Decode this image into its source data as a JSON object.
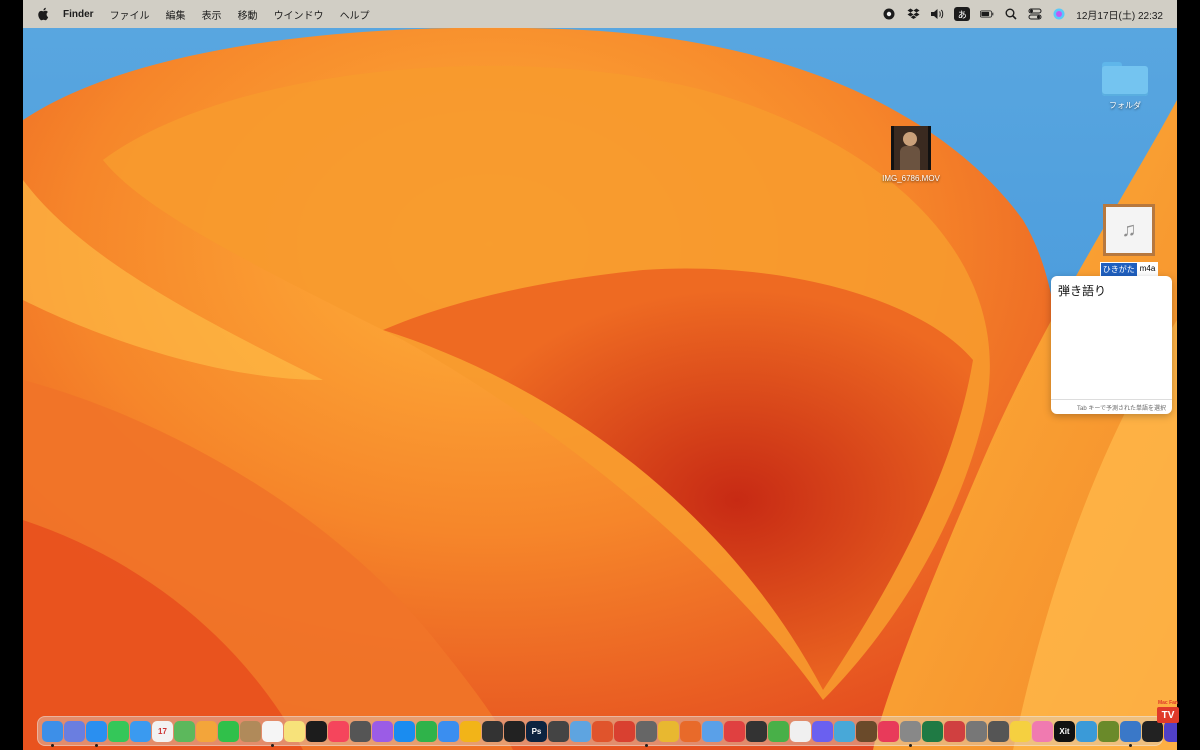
{
  "menubar": {
    "app_name": "Finder",
    "menus": [
      "ファイル",
      "編集",
      "表示",
      "移動",
      "ウインドウ",
      "ヘルプ"
    ],
    "input_source": "あ",
    "clock": "12月17日(土)  22:32"
  },
  "desktop": {
    "folder": {
      "label": "フォルダ"
    },
    "movie": {
      "label": "IMG_6786.MOV"
    },
    "audio": {
      "label_selected": "ひきがた",
      "label_rest": "m4a"
    }
  },
  "ime": {
    "candidate": "弾き語り",
    "hint": "Tab キーで予測された単語を選択"
  },
  "dock": {
    "apps": [
      {
        "icon": "finder-icon",
        "color": "#3d8fe8",
        "running": true
      },
      {
        "icon": "launchpad-icon",
        "color": "#6a7ee0",
        "running": false
      },
      {
        "icon": "safari-icon",
        "color": "#2a8ff0",
        "running": true
      },
      {
        "icon": "messages-icon",
        "color": "#34c759",
        "running": false
      },
      {
        "icon": "mail-icon",
        "color": "#3a9af0",
        "running": false
      },
      {
        "icon": "calendar-icon",
        "color": "#f2f2f2",
        "running": false,
        "text": "17"
      },
      {
        "icon": "maps-icon",
        "color": "#5cb85c",
        "running": false
      },
      {
        "icon": "photos-icon",
        "color": "#f3a53a",
        "running": false
      },
      {
        "icon": "facetime-icon",
        "color": "#30c04a",
        "running": false
      },
      {
        "icon": "contacts-icon",
        "color": "#b08a5a",
        "running": false
      },
      {
        "icon": "reminders-icon",
        "color": "#f5f5f5",
        "running": true
      },
      {
        "icon": "notes-icon",
        "color": "#f7e27a",
        "running": false
      },
      {
        "icon": "tv-icon",
        "color": "#1c1c1c",
        "running": false
      },
      {
        "icon": "music-icon",
        "color": "#f5455c",
        "running": false
      },
      {
        "icon": "podcasts-icon",
        "color": "#555",
        "running": false
      },
      {
        "icon": "podcasts-purple-icon",
        "color": "#9b5ce6",
        "running": false
      },
      {
        "icon": "appstore-icon",
        "color": "#1a8cf0",
        "running": false
      },
      {
        "icon": "numbers-icon",
        "color": "#2fb34a",
        "running": false
      },
      {
        "icon": "keynote-icon",
        "color": "#3a8ef0",
        "running": false
      },
      {
        "icon": "pencil-icon",
        "color": "#f2b418",
        "running": false
      },
      {
        "icon": "screenshot-icon",
        "color": "#333",
        "running": false
      },
      {
        "icon": "claquette-icon",
        "color": "#222",
        "running": false
      },
      {
        "icon": "photoshop-icon",
        "color": "#0d2440",
        "running": false,
        "text": "Ps"
      },
      {
        "icon": "finalcut-icon",
        "color": "#444",
        "running": false
      },
      {
        "icon": "preview-icon",
        "color": "#5ea4e0",
        "running": false
      },
      {
        "icon": "firefox-icon",
        "color": "#e0542c",
        "running": false
      },
      {
        "icon": "airplane-icon",
        "color": "#d94030",
        "running": false
      },
      {
        "icon": "microphone-icon",
        "color": "#666",
        "running": true
      },
      {
        "icon": "chrome-icon",
        "color": "#e8b830",
        "running": false
      },
      {
        "icon": "firefox-alt-icon",
        "color": "#e86a2a",
        "running": false
      },
      {
        "icon": "bird-icon",
        "color": "#5aa0e8",
        "running": false
      },
      {
        "icon": "target-icon",
        "color": "#e04040",
        "running": false
      },
      {
        "icon": "monitor-icon",
        "color": "#333",
        "running": false
      },
      {
        "icon": "checklist-icon",
        "color": "#48b048",
        "running": false
      },
      {
        "icon": "lasso-icon",
        "color": "#f0f0f0",
        "running": false
      },
      {
        "icon": "messenger-icon",
        "color": "#6a60f0",
        "running": false
      },
      {
        "icon": "finder-window-icon",
        "color": "#48a8d8",
        "running": false
      },
      {
        "icon": "game-icon",
        "color": "#6a4a2a",
        "running": false
      },
      {
        "icon": "play-icon",
        "color": "#e83a5a",
        "running": false
      },
      {
        "icon": "display-icon",
        "color": "#888",
        "running": true
      },
      {
        "icon": "excel-icon",
        "color": "#1f7a44",
        "running": false
      },
      {
        "icon": "shield-icon",
        "color": "#d04040",
        "running": false
      },
      {
        "icon": "mixer-icon",
        "color": "#777",
        "running": false
      },
      {
        "icon": "camera-icon",
        "color": "#555",
        "running": false
      },
      {
        "icon": "hand-icon",
        "color": "#f5d040",
        "running": false
      },
      {
        "icon": "grid-icon",
        "color": "#f07ab0",
        "running": false
      },
      {
        "icon": "xit-icon",
        "color": "#111",
        "running": false,
        "text": "Xit"
      },
      {
        "icon": "network-icon",
        "color": "#3a9ad8",
        "running": false
      },
      {
        "icon": "radar-icon",
        "color": "#6a8a2a",
        "running": false
      },
      {
        "icon": "person-icon",
        "color": "#3a78c8",
        "running": true
      },
      {
        "icon": "cube-icon",
        "color": "#222",
        "running": false
      },
      {
        "icon": "star-icon",
        "color": "#5040c8",
        "running": false
      }
    ],
    "trailing": [
      {
        "icon": "downloads-folder-icon",
        "color": "#5ab4e8"
      },
      {
        "icon": "trash-icon",
        "color": "#d8d8d8"
      }
    ]
  },
  "watermark": {
    "top": "Mac Fan",
    "tv": "TV"
  }
}
